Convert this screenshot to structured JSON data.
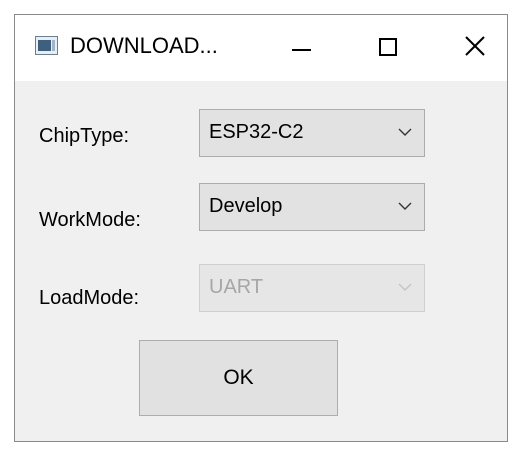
{
  "window": {
    "title": "DOWNLOAD...",
    "app_icon": "app-window-icon",
    "controls": [
      "minimize-icon",
      "maximize-icon",
      "close-icon"
    ]
  },
  "form": {
    "chip_type": {
      "label": "ChipType:",
      "value": "ESP32-C2",
      "enabled": true
    },
    "work_mode": {
      "label": "WorkMode:",
      "value": "Develop",
      "enabled": true
    },
    "load_mode": {
      "label": "LoadMode:",
      "value": "UART",
      "enabled": false
    }
  },
  "ok_label": "OK",
  "colors": {
    "titlebar": "#ffffff",
    "body": "#f0f0f0",
    "combo": "#e2e2e2",
    "disabled_text": "#a6a6a6"
  }
}
